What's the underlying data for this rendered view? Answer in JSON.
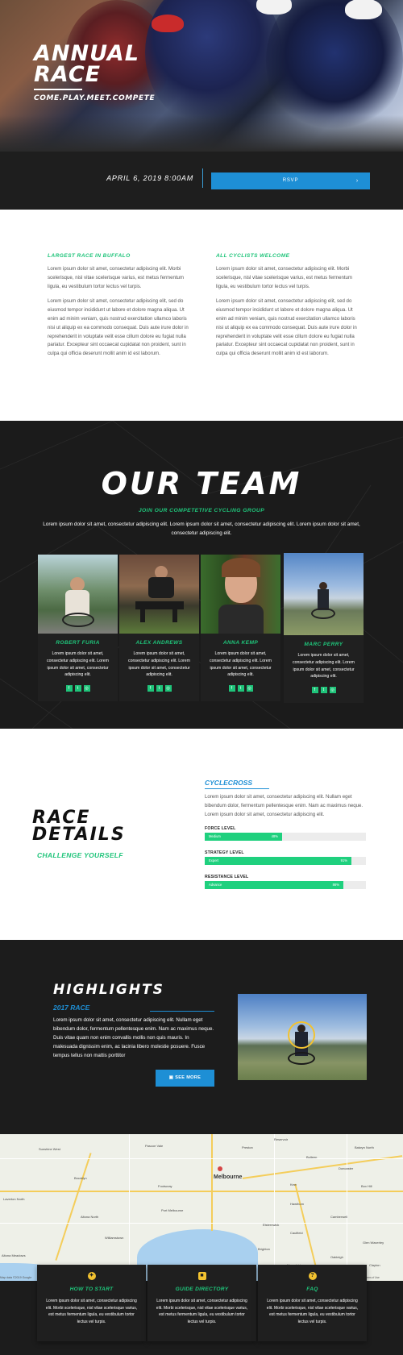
{
  "hero": {
    "title_line1": "ANNUAL",
    "title_line2": "RACE",
    "subtitle": "COME.PLAY.MEET.COMPETE"
  },
  "event": {
    "date": "APRIL 6, 2019 8:00AM",
    "rsvp_label": "RSVP",
    "rsvp_arrow": "›"
  },
  "intro": {
    "left": {
      "heading": "LARGEST RACE IN BUFFALO",
      "p1": "Lorem ipsum dolor sit amet, consectetur adipiscing elit. Morbi scelerisque, nisl vitae scelerisque varius, est metus fermentum ligula, eu vestibulum tortor lectus vel turpis.",
      "p2": "Lorem ipsum dolor sit amet, consectetur adipiscing elit, sed do eiusmod tempor incididunt ut labore et dolore magna aliqua. Ut enim ad minim veniam, quis nostrud exercitation ullamco laboris nisi ut aliquip ex ea commodo consequat. Duis aute irure dolor in reprehenderit in voluptate velit esse cillum dolore eu fugiat nulla pariatur. Excepteur sint occaecat cupidatat non proident, sunt in culpa qui officia deserunt mollit anim id est laborum."
    },
    "right": {
      "heading": "ALL CYCLISTS WELCOME",
      "p1": "Lorem ipsum dolor sit amet, consectetur adipiscing elit. Morbi scelerisque, nisl vitae scelerisque varius, est metus fermentum ligula, eu vestibulum tortor lectus vel turpis.",
      "p2": "Lorem ipsum dolor sit amet, consectetur adipiscing elit, sed do eiusmod tempor incididunt ut labore et dolore magna aliqua. Ut enim ad minim veniam, quis nostrud exercitation ullamco laboris nisi ut aliquip ex ea commodo consequat. Duis aute irure dolor in reprehenderit in voluptate velit esse cillum dolore eu fugiat nulla pariatur. Excepteur sint occaecat cupidatat non proident, sunt in culpa qui officia deserunt mollit anim id est laborum."
    }
  },
  "team": {
    "title": "OUR TEAM",
    "subtitle": "JOIN OUR COMPETETIVE CYCLING GROUP",
    "description": "Lorem ipsum dolor sit amet, consectetur adipiscing elit.  Lorem ipsum dolor sit amet, consectetur adipiscing elit.  Lorem ipsum dolor sit amet, consectetur adipiscing elit.",
    "members": [
      {
        "name": "ROBERT FURIA",
        "bio": "Lorem ipsum dolor sit amet, consectetur adipiscing elit. Lorem ipsum dolor sit amet, consectetur adipiscing elit."
      },
      {
        "name": "ALEX ANDREWS",
        "bio": "Lorem ipsum dolor sit amet, consectetur adipiscing elit. Lorem ipsum dolor sit amet, consectetur adipiscing elit."
      },
      {
        "name": "ANNA KEMP",
        "bio": "Lorem ipsum dolor sit amet, consectetur adipiscing elit. Lorem ipsum dolor sit amet, consectetur adipiscing elit."
      },
      {
        "name": "MARC PERRY",
        "bio": "Lorem ipsum dolor sit amet, consectetur adipiscing elit. Lorem ipsum dolor sit amet, consectetur adipiscing elit."
      }
    ],
    "social_icons": [
      "facebook-icon",
      "twitter-icon",
      "instagram-icon"
    ]
  },
  "details": {
    "title_line1": "RACE",
    "title_line2": "DETAILS",
    "subtitle": "CHALLENGE YOURSELF",
    "section_title": "CYCLECROSS",
    "description": "Lorem ipsum dolor sit amet, consectetur adipiscing elit. Nullam eget bibendum dolor, fermentum pellentesque enim. Nam ac maximus neque. Lorem ipsum dolor sit amet, consectetur adipiscing elit.",
    "bars": [
      {
        "label": "FORCE LEVEL",
        "level": "Medium",
        "percent_text": "48%",
        "value": 0.48
      },
      {
        "label": "STRATEGY LEVEL",
        "level": "Expert",
        "percent_text": "91%",
        "value": 0.91
      },
      {
        "label": "RESISTANCE LEVEL",
        "level": "Advance",
        "percent_text": "86%",
        "value": 0.86
      }
    ]
  },
  "highlights": {
    "title": "HIGHLIGHTS",
    "subtitle": "2017 RACE",
    "description": "Lorem ipsum dolor sit amet, consectetur adipiscing elit. Nullam eget bibendum dolor, fermentum pellentesque enim. Nam ac maximus neque. Duis vitae quam non enim convallis mollis non quis mauris. In malesuada dignissim enim, ac lacinia libero molestie posuere. Fusce tempus tellus non mattis porttitor",
    "button_label": "SEE MORE"
  },
  "map": {
    "city": "Melbourne",
    "labels": [
      "Sunshine West",
      "Pascoe Vale",
      "Preston",
      "Reservoir",
      "Bulleen",
      "Balwyn North",
      "Brooklyn",
      "Footscray",
      "Kew",
      "Box Hill",
      "Doncaster",
      "Altona North",
      "Williamstown",
      "Hawthorn",
      "Camberwell",
      "Glen Waverley",
      "Laverton North",
      "Port Melbourne",
      "Brighton",
      "Elsternwick",
      "Caulfield",
      "Oakleigh",
      "Altona Meadows",
      "Moorabbin",
      "Clayton"
    ],
    "attribution": "Map data ©2019 Google",
    "terms": "Terms of Use"
  },
  "info_cards": [
    {
      "icon": "runner-icon",
      "glyph": "✦",
      "title": "HOW TO START",
      "text": "Lorem ipsum dolor sit amet, consectetur adipiscing elit. Morbi scelerisque, nisl vitae scelerisque varius, est metus fermentum ligula, eu vestibulum tortor lectus vel turpis."
    },
    {
      "icon": "contact-card-icon",
      "glyph": "■",
      "title": "GUIDE DIRECTORY",
      "text": "Lorem ipsum dolor sit amet, consectetur adipiscing elit. Morbi scelerisque, nisl vitae scelerisque varius, est metus fermentum ligula, eu vestibulum tortor lectus vel turpis."
    },
    {
      "icon": "question-icon",
      "glyph": "?",
      "title": "FAQ",
      "text": "Lorem ipsum dolor sit amet, consectetur adipiscing elit. Morbi scelerisque, nisl vitae scelerisque varius, est metus fermentum ligula, eu vestibulum tortor lectus vel turpis."
    }
  ],
  "colors": {
    "accent_green": "#1fc47a",
    "accent_blue": "#1e8fd5",
    "dark": "#1c1c1c",
    "icon_yellow": "#f2c230"
  }
}
